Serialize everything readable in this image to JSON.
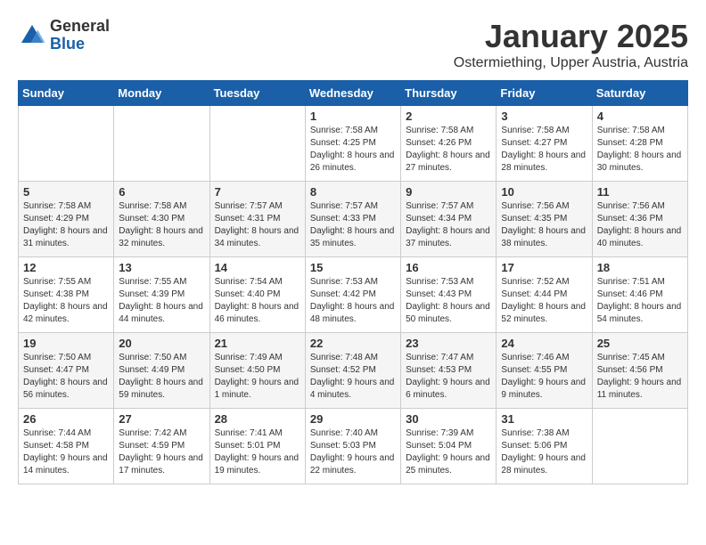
{
  "logo": {
    "general": "General",
    "blue": "Blue"
  },
  "title": "January 2025",
  "subtitle": "Ostermiething, Upper Austria, Austria",
  "days_header": [
    "Sunday",
    "Monday",
    "Tuesday",
    "Wednesday",
    "Thursday",
    "Friday",
    "Saturday"
  ],
  "weeks": [
    [
      {
        "day": "",
        "info": ""
      },
      {
        "day": "",
        "info": ""
      },
      {
        "day": "",
        "info": ""
      },
      {
        "day": "1",
        "info": "Sunrise: 7:58 AM\nSunset: 4:25 PM\nDaylight: 8 hours and 26 minutes."
      },
      {
        "day": "2",
        "info": "Sunrise: 7:58 AM\nSunset: 4:26 PM\nDaylight: 8 hours and 27 minutes."
      },
      {
        "day": "3",
        "info": "Sunrise: 7:58 AM\nSunset: 4:27 PM\nDaylight: 8 hours and 28 minutes."
      },
      {
        "day": "4",
        "info": "Sunrise: 7:58 AM\nSunset: 4:28 PM\nDaylight: 8 hours and 30 minutes."
      }
    ],
    [
      {
        "day": "5",
        "info": "Sunrise: 7:58 AM\nSunset: 4:29 PM\nDaylight: 8 hours and 31 minutes."
      },
      {
        "day": "6",
        "info": "Sunrise: 7:58 AM\nSunset: 4:30 PM\nDaylight: 8 hours and 32 minutes."
      },
      {
        "day": "7",
        "info": "Sunrise: 7:57 AM\nSunset: 4:31 PM\nDaylight: 8 hours and 34 minutes."
      },
      {
        "day": "8",
        "info": "Sunrise: 7:57 AM\nSunset: 4:33 PM\nDaylight: 8 hours and 35 minutes."
      },
      {
        "day": "9",
        "info": "Sunrise: 7:57 AM\nSunset: 4:34 PM\nDaylight: 8 hours and 37 minutes."
      },
      {
        "day": "10",
        "info": "Sunrise: 7:56 AM\nSunset: 4:35 PM\nDaylight: 8 hours and 38 minutes."
      },
      {
        "day": "11",
        "info": "Sunrise: 7:56 AM\nSunset: 4:36 PM\nDaylight: 8 hours and 40 minutes."
      }
    ],
    [
      {
        "day": "12",
        "info": "Sunrise: 7:55 AM\nSunset: 4:38 PM\nDaylight: 8 hours and 42 minutes."
      },
      {
        "day": "13",
        "info": "Sunrise: 7:55 AM\nSunset: 4:39 PM\nDaylight: 8 hours and 44 minutes."
      },
      {
        "day": "14",
        "info": "Sunrise: 7:54 AM\nSunset: 4:40 PM\nDaylight: 8 hours and 46 minutes."
      },
      {
        "day": "15",
        "info": "Sunrise: 7:53 AM\nSunset: 4:42 PM\nDaylight: 8 hours and 48 minutes."
      },
      {
        "day": "16",
        "info": "Sunrise: 7:53 AM\nSunset: 4:43 PM\nDaylight: 8 hours and 50 minutes."
      },
      {
        "day": "17",
        "info": "Sunrise: 7:52 AM\nSunset: 4:44 PM\nDaylight: 8 hours and 52 minutes."
      },
      {
        "day": "18",
        "info": "Sunrise: 7:51 AM\nSunset: 4:46 PM\nDaylight: 8 hours and 54 minutes."
      }
    ],
    [
      {
        "day": "19",
        "info": "Sunrise: 7:50 AM\nSunset: 4:47 PM\nDaylight: 8 hours and 56 minutes."
      },
      {
        "day": "20",
        "info": "Sunrise: 7:50 AM\nSunset: 4:49 PM\nDaylight: 8 hours and 59 minutes."
      },
      {
        "day": "21",
        "info": "Sunrise: 7:49 AM\nSunset: 4:50 PM\nDaylight: 9 hours and 1 minute."
      },
      {
        "day": "22",
        "info": "Sunrise: 7:48 AM\nSunset: 4:52 PM\nDaylight: 9 hours and 4 minutes."
      },
      {
        "day": "23",
        "info": "Sunrise: 7:47 AM\nSunset: 4:53 PM\nDaylight: 9 hours and 6 minutes."
      },
      {
        "day": "24",
        "info": "Sunrise: 7:46 AM\nSunset: 4:55 PM\nDaylight: 9 hours and 9 minutes."
      },
      {
        "day": "25",
        "info": "Sunrise: 7:45 AM\nSunset: 4:56 PM\nDaylight: 9 hours and 11 minutes."
      }
    ],
    [
      {
        "day": "26",
        "info": "Sunrise: 7:44 AM\nSunset: 4:58 PM\nDaylight: 9 hours and 14 minutes."
      },
      {
        "day": "27",
        "info": "Sunrise: 7:42 AM\nSunset: 4:59 PM\nDaylight: 9 hours and 17 minutes."
      },
      {
        "day": "28",
        "info": "Sunrise: 7:41 AM\nSunset: 5:01 PM\nDaylight: 9 hours and 19 minutes."
      },
      {
        "day": "29",
        "info": "Sunrise: 7:40 AM\nSunset: 5:03 PM\nDaylight: 9 hours and 22 minutes."
      },
      {
        "day": "30",
        "info": "Sunrise: 7:39 AM\nSunset: 5:04 PM\nDaylight: 9 hours and 25 minutes."
      },
      {
        "day": "31",
        "info": "Sunrise: 7:38 AM\nSunset: 5:06 PM\nDaylight: 9 hours and 28 minutes."
      },
      {
        "day": "",
        "info": ""
      }
    ]
  ]
}
